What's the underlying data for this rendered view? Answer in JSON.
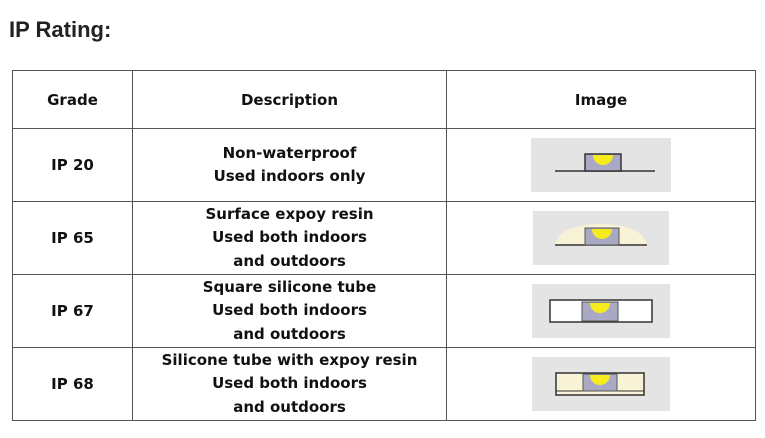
{
  "heading": "IP Rating:",
  "table": {
    "headers": [
      "Grade",
      "Description",
      "Image"
    ],
    "rows": [
      {
        "grade": "IP 20",
        "desc": [
          "Non-waterproof",
          "Used indoors only"
        ],
        "icon": "ip20-strip-icon"
      },
      {
        "grade": "IP 65",
        "desc": [
          "Surface expoy resin",
          "Used both indoors",
          "and outdoors"
        ],
        "icon": "ip65-resin-coated-strip-icon"
      },
      {
        "grade": "IP 67",
        "desc": [
          "Square silicone tube",
          "Used both indoors",
          "and outdoors"
        ],
        "icon": "ip67-silicone-tube-strip-icon"
      },
      {
        "grade": "IP 68",
        "desc": [
          "Silicone tube with expoy resin",
          "Used both indoors",
          "and outdoors"
        ],
        "icon": "ip68-tube-resin-strip-icon"
      }
    ]
  },
  "colors": {
    "led": "#f5ec1e",
    "resin": "#f8f3d6",
    "chip": "#a9a9c4",
    "image_bg": "#e4e4e4"
  }
}
